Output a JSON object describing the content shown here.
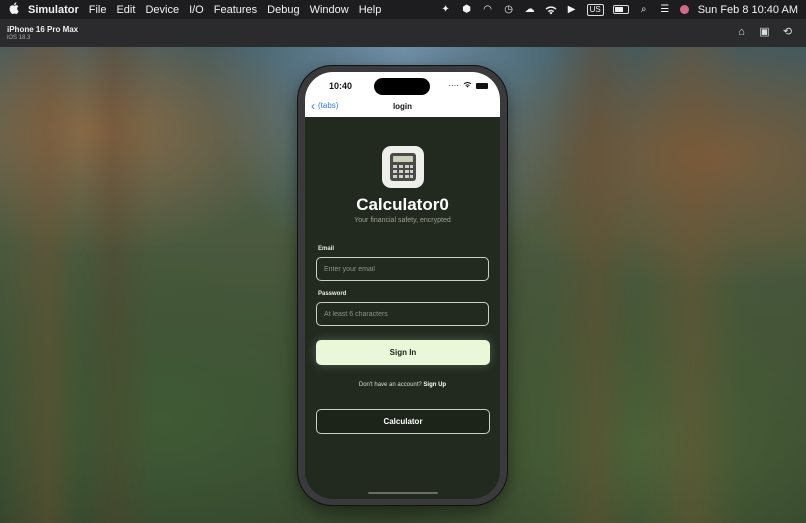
{
  "menubar": {
    "app_name": "Simulator",
    "menus": [
      "File",
      "Edit",
      "Device",
      "I/O",
      "Features",
      "Debug",
      "Window",
      "Help"
    ],
    "input_source": "US",
    "datetime": "Sun Feb 8  10:40 AM"
  },
  "simulator": {
    "device_name": "iPhone 16 Pro Max",
    "os_version": "iOS 18.3"
  },
  "phone": {
    "time": "10:40",
    "nav": {
      "back_label": "(tabs)",
      "title": "login"
    },
    "app_title": "Calculator0",
    "subtitle": "Your financial safety, encrypted",
    "email": {
      "label": "Email",
      "placeholder": "Enter your email",
      "value": ""
    },
    "password": {
      "label": "Password",
      "placeholder": "At least 6 characters",
      "value": ""
    },
    "signin_label": "Sign In",
    "signup_prompt": "Don't have an account?",
    "signup_link": "Sign Up",
    "calculator_label": "Calculator"
  },
  "colors": {
    "accent": "#2f7cf6",
    "primary_button": "#eaf7d8",
    "screen_bg": "#222a20"
  }
}
